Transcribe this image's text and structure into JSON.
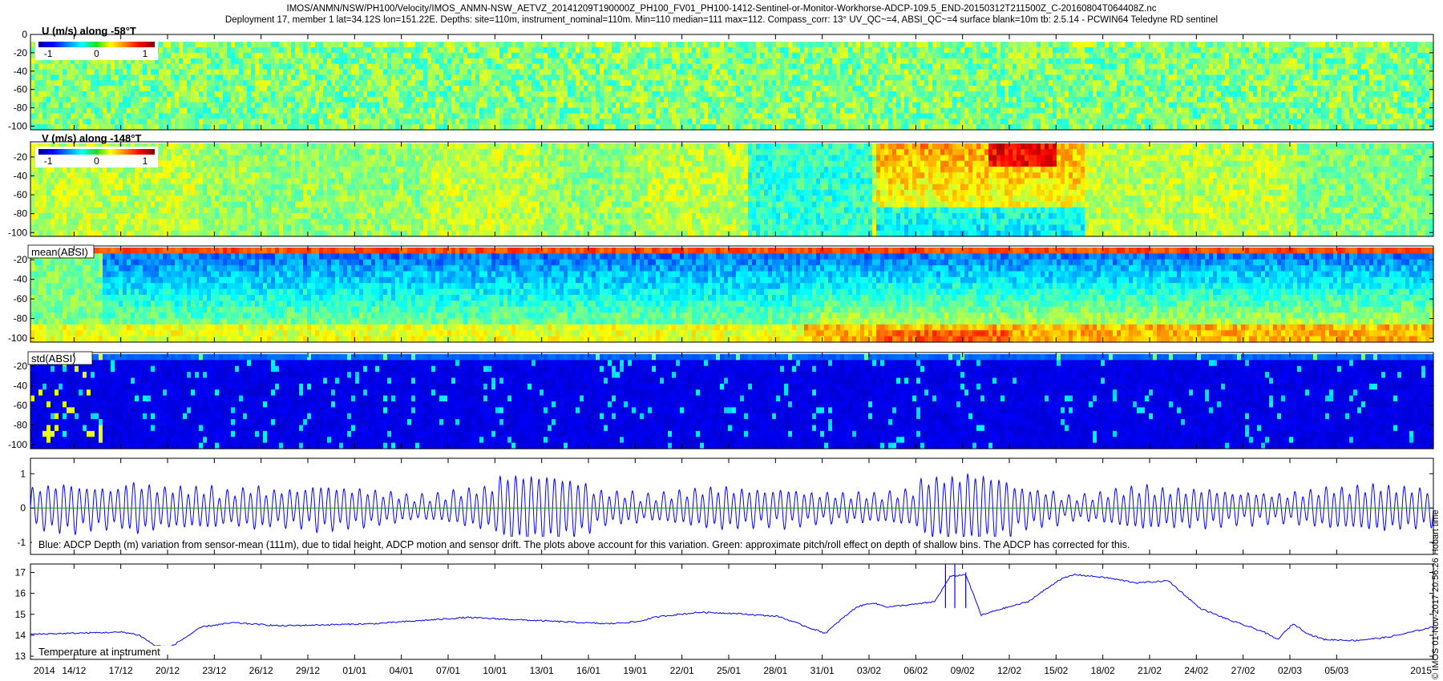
{
  "header": {
    "title_line1": "IMOS/ANMN/NSW/PH100/Velocity/IMOS_ANMN-NSW_AETVZ_20141209T190000Z_PH100_FV01_PH100-1412-Sentinel-or-Monitor-Workhorse-ADCP-109.5_END-20150312T211500Z_C-20160804T064408Z.nc",
    "title_line2": "Deployment 17, member 1 lat=34.12S lon=151.22E. Depths: site=110m, instrument_nominal=110m. Min=110 median=111 max=112. Compass_corr: 13° UV_QC~=4, ABSI_QC~=4 surface blank=10m tb: 2.5.14 - PCWIN64 Teledyne RD sentinel"
  },
  "side_text": "© IMOS 01-Nov-2017 20:56:26 Hobart time",
  "time_axis": {
    "tick_labels": [
      "14/12",
      "17/12",
      "20/12",
      "23/12",
      "26/12",
      "29/12",
      "01/01",
      "04/01",
      "07/01",
      "10/01",
      "13/01",
      "16/01",
      "19/01",
      "22/01",
      "25/01",
      "28/01",
      "31/01",
      "03/02",
      "06/02",
      "09/02",
      "12/02",
      "15/02",
      "18/02",
      "21/02",
      "24/02",
      "27/02",
      "02/03",
      "05/03"
    ],
    "year_start": "2014",
    "year_end": "2015"
  },
  "colorbar": {
    "tick_labels": [
      "-1",
      "0",
      "1"
    ]
  },
  "chart_data": [
    {
      "type": "heatmap",
      "label": "U (m/s) along -58°T",
      "y_ticks": [
        "0",
        "-20",
        "-40",
        "-60",
        "-80",
        "-100"
      ],
      "ylim": [
        -104,
        0
      ],
      "clim": [
        -1.2,
        1.2
      ],
      "colormap": "jet",
      "description_values": {
        "dominant_value": 0.0,
        "range": [
          -0.5,
          0.6
        ]
      }
    },
    {
      "type": "heatmap",
      "label": "V (m/s) along -148°T",
      "y_ticks": [
        "-20",
        "-40",
        "-60",
        "-80",
        "-100"
      ],
      "ylim": [
        -104,
        -4
      ],
      "clim": [
        -1.2,
        1.2
      ],
      "colormap": "jet",
      "description_values": {
        "dominant_value": 0.3,
        "range": [
          -0.4,
          1.2
        ]
      }
    },
    {
      "type": "heatmap",
      "label": "mean(ABSI)",
      "y_ticks": [
        "-20",
        "-40",
        "-60",
        "-80",
        "-100"
      ],
      "ylim": [
        -104,
        -6
      ],
      "colormap": "jet"
    },
    {
      "type": "heatmap",
      "label": "std(ABSI)",
      "y_ticks": [
        "-20",
        "-40",
        "-60",
        "-80",
        "-100"
      ],
      "ylim": [
        -104,
        -6
      ],
      "colormap": "jet"
    },
    {
      "type": "line",
      "y_ticks": [
        "1",
        "0",
        "-1"
      ],
      "ylim": [
        -1.35,
        1.45
      ],
      "note": "Blue: ADCP Depth (m) variation from sensor-mean (111m), due to tidal height, ADCP motion and sensor drift. The plots above account for this variation. Green: approximate pitch/roll effect on depth of shallow bins. The ADCP has corrected for this.",
      "series": [
        {
          "color": "#0000ff",
          "amplitude_envelope": [
            0.6,
            0.5,
            0.75,
            0.85,
            0.6,
            0.45,
            0.55,
            0.6,
            0.5,
            0.55,
            0.8,
            0.85,
            0.65,
            0.5,
            0.5,
            0.45,
            0.55,
            0.6,
            0.5,
            0.75,
            0.85,
            0.7,
            0.5,
            0.55,
            0.45,
            0.5,
            0.6,
            0.65,
            0.55,
            0.5
          ],
          "oscillation_period_days": 0.5,
          "offset": 0.0
        },
        {
          "color": "#00a000",
          "value": 0.0
        }
      ]
    },
    {
      "type": "line",
      "label": "Temperature at instrument",
      "y_ticks": [
        "17",
        "16",
        "15",
        "14",
        "13"
      ],
      "ylim": [
        12.85,
        17.4
      ],
      "series": [
        {
          "color": "#0000ff",
          "x": [
            0,
            3,
            6,
            7,
            8,
            9,
            11,
            13,
            16,
            19,
            22,
            25,
            28,
            31,
            34,
            37,
            39,
            40,
            41,
            43,
            45,
            48,
            50,
            51,
            52,
            53,
            54,
            55,
            57,
            58,
            59,
            60,
            61,
            62,
            64,
            66,
            67,
            69,
            71,
            73,
            75,
            77,
            79,
            80,
            81,
            82,
            83,
            85,
            87,
            88,
            90
          ],
          "y": [
            14.05,
            14.1,
            14.15,
            14.0,
            13.5,
            13.45,
            14.4,
            14.6,
            14.45,
            14.5,
            14.55,
            14.7,
            14.85,
            14.75,
            14.65,
            14.55,
            14.65,
            14.85,
            14.95,
            15.1,
            15.05,
            14.9,
            14.35,
            14.1,
            14.75,
            15.35,
            15.55,
            15.35,
            15.5,
            15.6,
            16.8,
            16.9,
            14.95,
            15.2,
            15.6,
            16.65,
            16.9,
            16.75,
            16.5,
            16.6,
            15.3,
            14.7,
            14.2,
            13.8,
            14.55,
            14.05,
            13.8,
            13.75,
            13.9,
            14.05,
            14.4
          ]
        }
      ],
      "spikes": [
        {
          "x": 58.7,
          "y": 17.4
        },
        {
          "x": 59.3,
          "y": 17.4
        },
        {
          "x": 60.0,
          "y": 17.0
        }
      ]
    }
  ]
}
